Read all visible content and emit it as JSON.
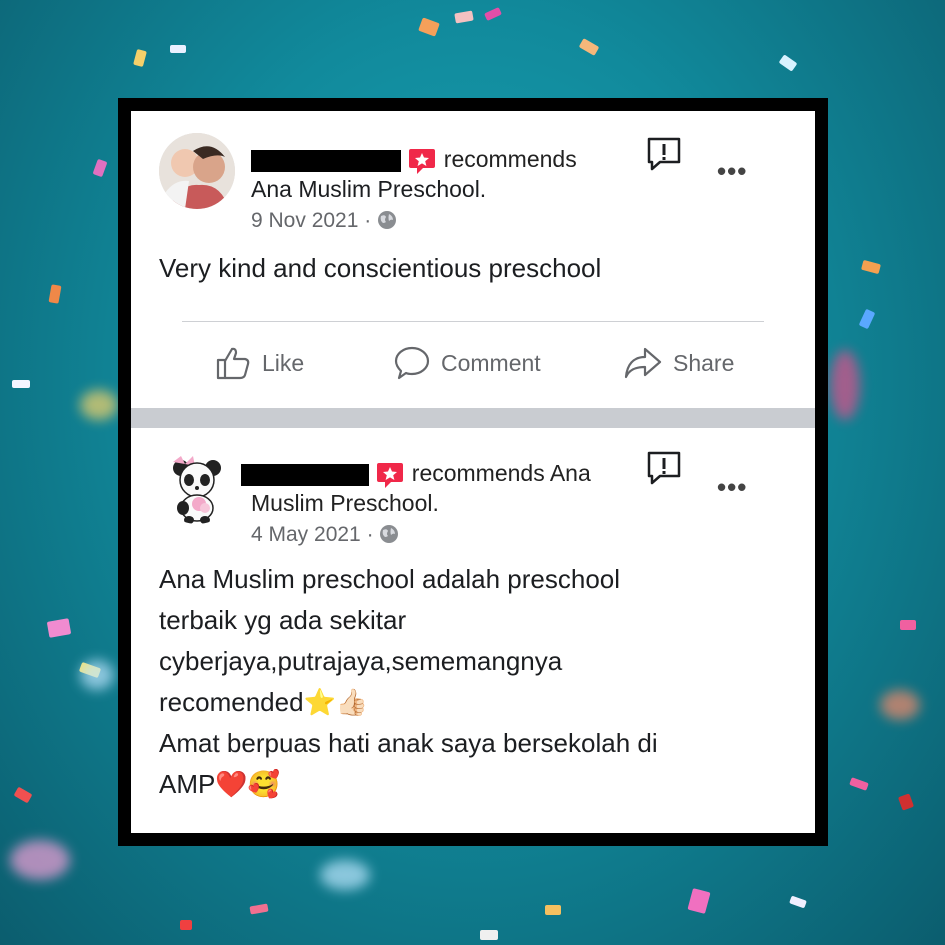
{
  "posts": [
    {
      "recommends_text": "recommends",
      "page_name": "Ana Muslim Preschool.",
      "date": "9 Nov 2021",
      "separator": "·",
      "body": "Very kind and conscientious preschool",
      "actions": {
        "like": "Like",
        "comment": "Comment",
        "share": "Share"
      }
    },
    {
      "recommends_text": "recommends Ana",
      "page_name": "Muslim Preschool.",
      "date": "4 May 2021",
      "separator": "·",
      "body_lines": [
        "Ana Muslim preschool adalah preschool",
        "terbaik yg ada sekitar",
        "cyberjaya,putrajaya,sememangnya",
        "recomended⭐👍🏻",
        "Amat berpuas hati anak saya bersekolah di",
        "AMP❤️🥰"
      ]
    }
  ],
  "colors": {
    "recommend_badge": "#f02849",
    "separator": "#c9ccd1",
    "muted_text": "#65676b"
  },
  "icons": [
    "recommend-badge-icon",
    "globe-icon",
    "report-icon",
    "more-icon",
    "like-icon",
    "comment-icon",
    "share-icon"
  ]
}
